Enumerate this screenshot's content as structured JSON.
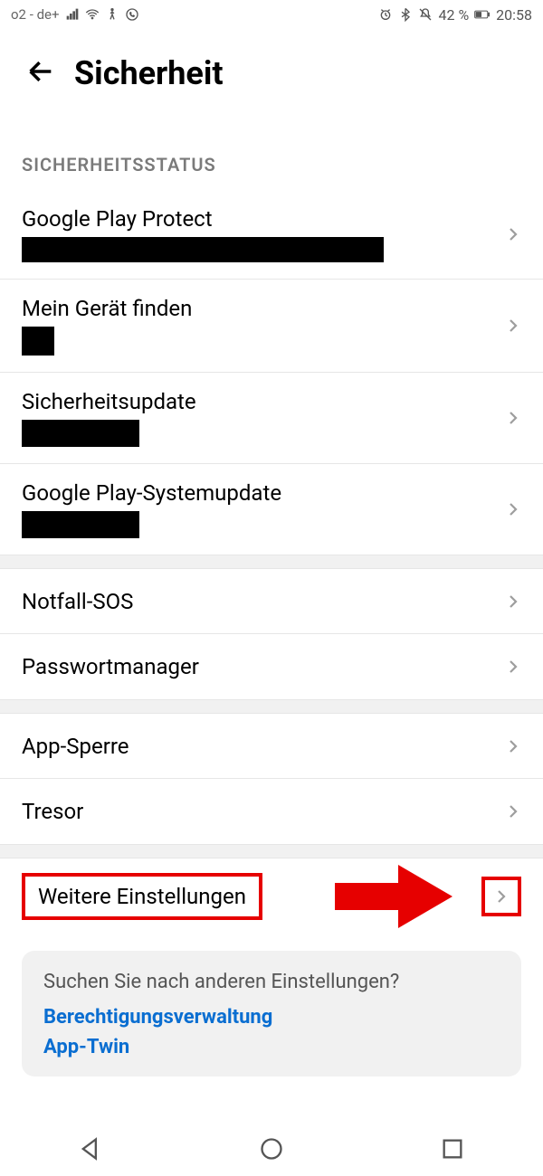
{
  "status_bar": {
    "carrier": "o2 - de+",
    "battery_percent": "42 %",
    "time": "20:58"
  },
  "header": {
    "title": "Sicherheit"
  },
  "sections": {
    "status_header": "SICHERHEITSSTATUS"
  },
  "items": {
    "play_protect": "Google Play Protect",
    "find_device": "Mein Gerät finden",
    "security_update": "Sicherheitsupdate",
    "play_system_update": "Google Play-Systemupdate",
    "emergency_sos": "Notfall-SOS",
    "password_manager": "Passwortmanager",
    "app_lock": "App-Sperre",
    "vault": "Tresor",
    "more_settings": "Weitere Einstellungen"
  },
  "suggestion": {
    "title": "Suchen Sie nach anderen Einstellungen?",
    "link1": "Berechtigungsverwaltung",
    "link2": "App-Twin"
  }
}
